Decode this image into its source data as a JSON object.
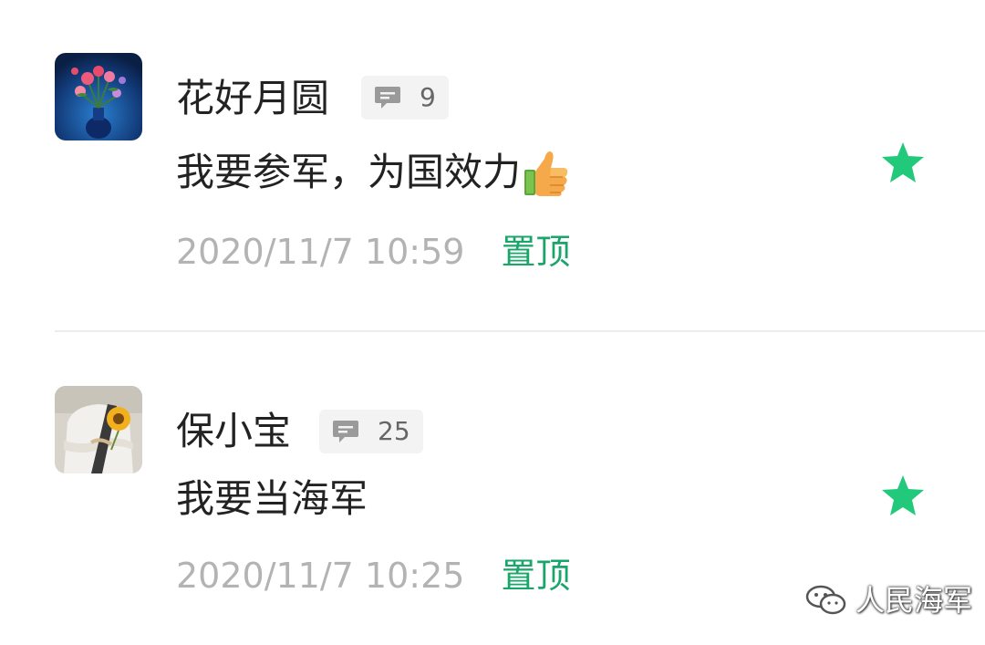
{
  "comments": [
    {
      "user_name": "花好月圆",
      "reply_count": "9",
      "content": "我要参军，为国效力",
      "content_emoji": "thumbs-up-icon",
      "timestamp": "2020/11/7 10:59",
      "pin_label": "置顶",
      "starred": true
    },
    {
      "user_name": "保小宝",
      "reply_count": "25",
      "content": "我要当海军",
      "timestamp": "2020/11/7 10:25",
      "pin_label": "置顶",
      "starred": true
    }
  ],
  "watermark": {
    "text": "人民海军",
    "icon": "wechat-icon"
  },
  "colors": {
    "accent_green": "#1aa56a",
    "star_green": "#22c97a",
    "timestamp_gray": "#b3b3b3",
    "badge_bg": "#f3f3f3"
  }
}
